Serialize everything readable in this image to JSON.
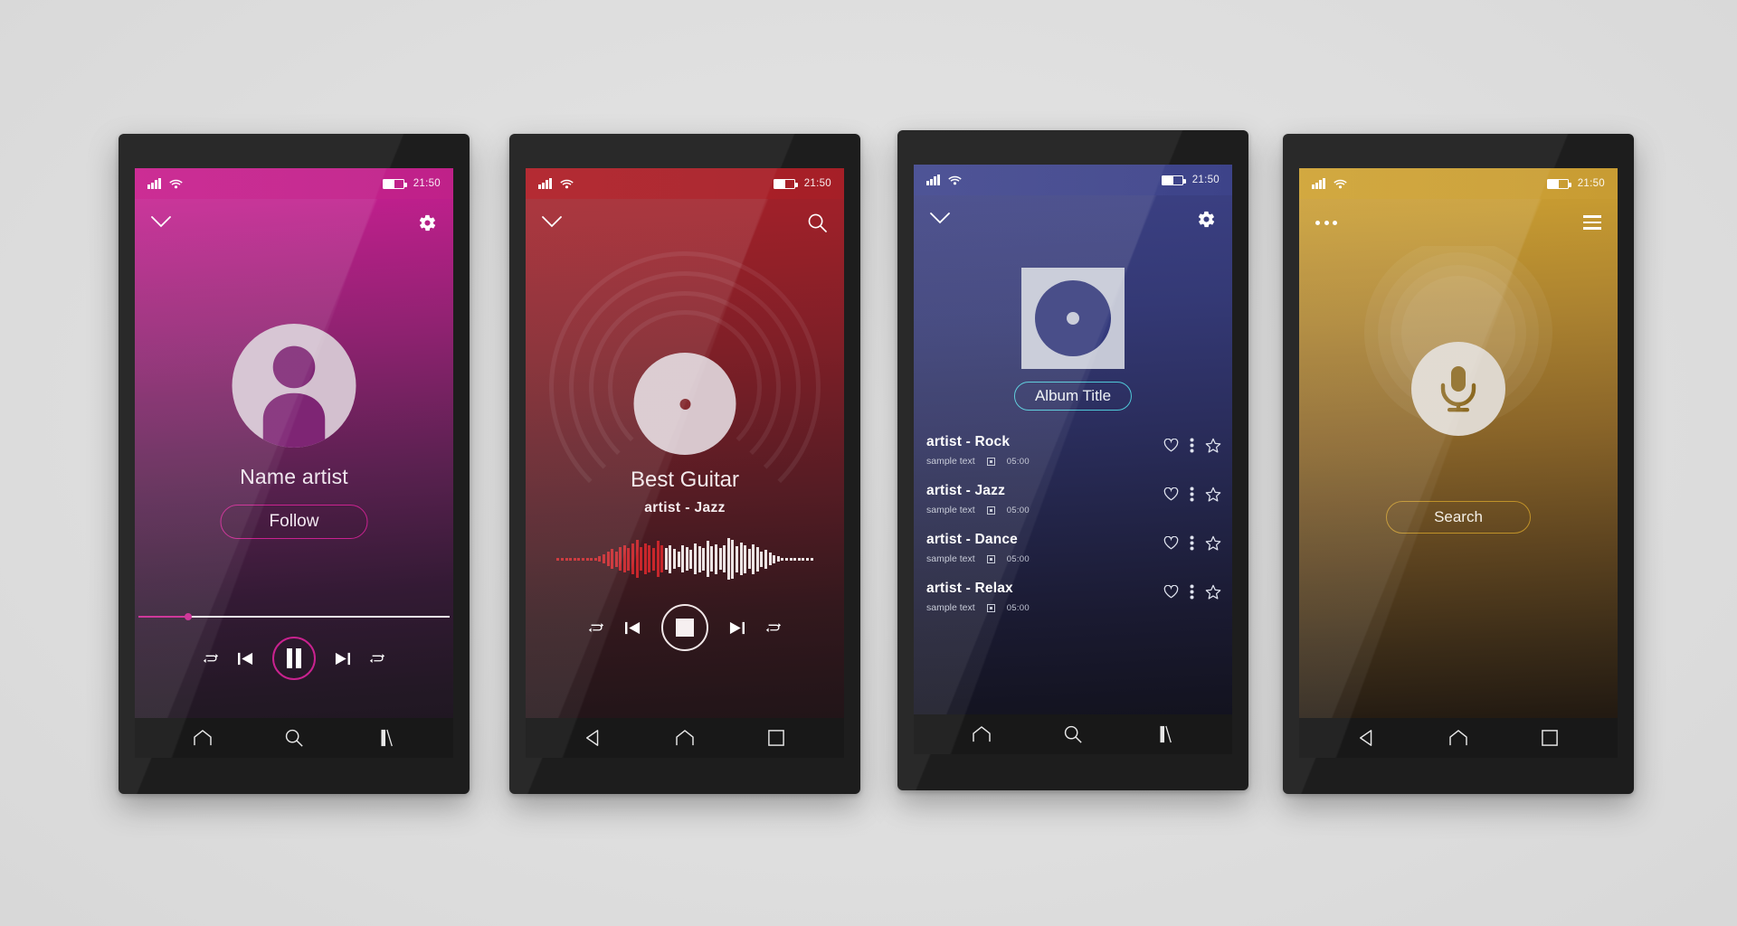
{
  "canvas": {
    "background": "#e2e2e2"
  },
  "status_bar": {
    "time": "21:50",
    "signal_bars": 4,
    "wifi": true,
    "battery_level_pct": 58
  },
  "phones": [
    {
      "id": "artist-profile",
      "accent": "#c9228f",
      "header": {
        "left_icon": "chevron-down-icon",
        "right_icon": "gear-icon"
      },
      "avatar_icon": "user-avatar-icon",
      "artist_name": "Name artist",
      "follow_label": "Follow",
      "progress_pct": 16,
      "controls": [
        "shuffle-icon",
        "previous-track-icon",
        "pause-icon",
        "next-track-icon",
        "repeat-icon"
      ],
      "nav": [
        "home-icon",
        "search-icon",
        "recents-icon"
      ]
    },
    {
      "id": "now-playing",
      "accent": "#b02028",
      "header": {
        "left_icon": "chevron-down-icon",
        "right_icon": "search-icon"
      },
      "track_title": "Best Guitar",
      "track_subtitle": "artist - Jazz",
      "controls": [
        "shuffle-icon",
        "previous-track-icon",
        "stop-icon",
        "next-track-icon",
        "repeat-icon"
      ],
      "nav": [
        "back-icon",
        "home-icon",
        "recents-square-icon"
      ],
      "waveform": {
        "played_color": "#c8262b",
        "remaining_color": "#ece4e4",
        "played_count": 26,
        "heights": [
          3,
          3,
          3,
          3,
          3,
          3,
          3,
          3,
          3,
          3,
          6,
          10,
          16,
          22,
          17,
          26,
          30,
          25,
          34,
          42,
          26,
          34,
          30,
          25,
          40,
          30,
          24,
          31,
          22,
          17,
          30,
          26,
          21,
          34,
          29,
          25,
          40,
          28,
          33,
          24,
          30,
          46,
          43,
          29,
          36,
          31,
          22,
          33,
          27,
          17,
          21,
          14,
          9,
          6,
          3,
          3,
          3,
          3,
          3,
          3,
          3,
          3
        ]
      }
    },
    {
      "id": "album-tracklist",
      "accent": "#4fc8d8",
      "header": {
        "left_icon": "chevron-down-icon",
        "right_icon": "gear-icon"
      },
      "album_art_icon": "vinyl-record-icon",
      "album_title": "Album Title",
      "tracks": [
        {
          "title": "artist - Rock",
          "subtitle": "sample text",
          "duration": "05:00"
        },
        {
          "title": "artist - Jazz",
          "subtitle": "sample text",
          "duration": "05:00"
        },
        {
          "title": "artist - Dance",
          "subtitle": "sample text",
          "duration": "05:00"
        },
        {
          "title": "artist - Relax",
          "subtitle": "sample text",
          "duration": "05:00"
        }
      ],
      "row_icons": [
        "heart-icon",
        "more-vertical-icon",
        "star-icon"
      ],
      "nav": [
        "home-icon",
        "search-icon",
        "recents-icon"
      ]
    },
    {
      "id": "voice-search",
      "accent": "#c09229",
      "header": {
        "left_icon": "more-horizontal-icon",
        "right_icon": "hamburger-menu-icon"
      },
      "mic_icon": "microphone-icon",
      "search_label": "Search",
      "nav": [
        "back-icon",
        "home-icon",
        "recents-square-icon"
      ]
    }
  ]
}
